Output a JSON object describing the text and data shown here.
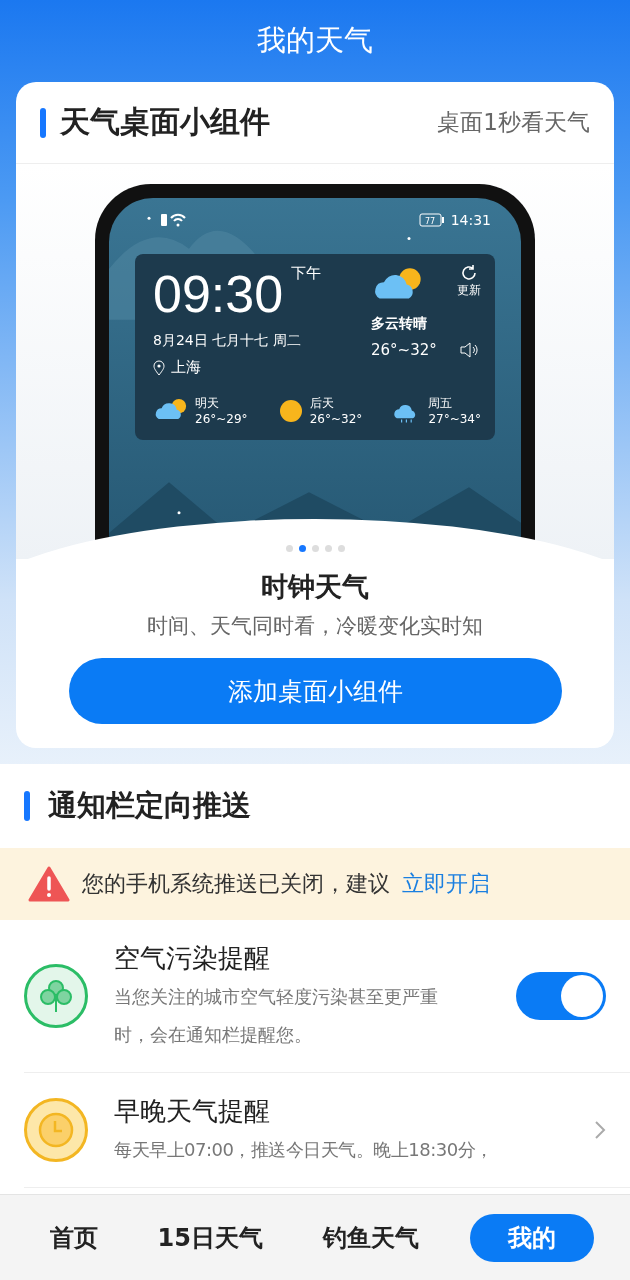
{
  "header": {
    "title": "我的天气"
  },
  "widget_card": {
    "title": "天气桌面小组件",
    "subtitle": "桌面1秒看天气",
    "preview": {
      "battery": "77",
      "status_time": "14:31",
      "time": "09:30",
      "ampm": "下午",
      "date": "8月24日 七月十七 周二",
      "city": "上海",
      "refresh": "更新",
      "condition": "多云转晴",
      "temp": "26°~32°",
      "forecast": [
        {
          "day": "明天",
          "temp": "26°~29°",
          "kind": "partly_cloudy"
        },
        {
          "day": "后天",
          "temp": "26°~32°",
          "kind": "sunny"
        },
        {
          "day": "周五",
          "temp": "27°~34°",
          "kind": "rain"
        }
      ]
    },
    "pager": [
      {
        "selected": false
      },
      {
        "selected": true
      },
      {
        "selected": false
      },
      {
        "selected": false
      },
      {
        "selected": false
      }
    ],
    "name": "时钟天气",
    "description": "时间、天气同时看，冷暖变化实时知",
    "button": "添加桌面小组件"
  },
  "notifications": {
    "title": "通知栏定向推送",
    "warning": {
      "text": "您的手机系统推送已关闭，建议",
      "link": "立即开启"
    },
    "items": [
      {
        "kind": "toggle",
        "title": "空气污染提醒",
        "description": "当您关注的城市空气轻度污染甚至更严重时，会在通知栏提醒您。",
        "on": true
      },
      {
        "kind": "link",
        "title": "早晚天气提醒",
        "description": "每天早上07:00，推送今日天气。晚上18:30分，"
      }
    ]
  },
  "tabs": [
    {
      "label": "首页",
      "selected": false
    },
    {
      "label": "15日天气",
      "selected": false
    },
    {
      "label": "钓鱼天气",
      "selected": false
    },
    {
      "label": "我的",
      "selected": true
    }
  ]
}
